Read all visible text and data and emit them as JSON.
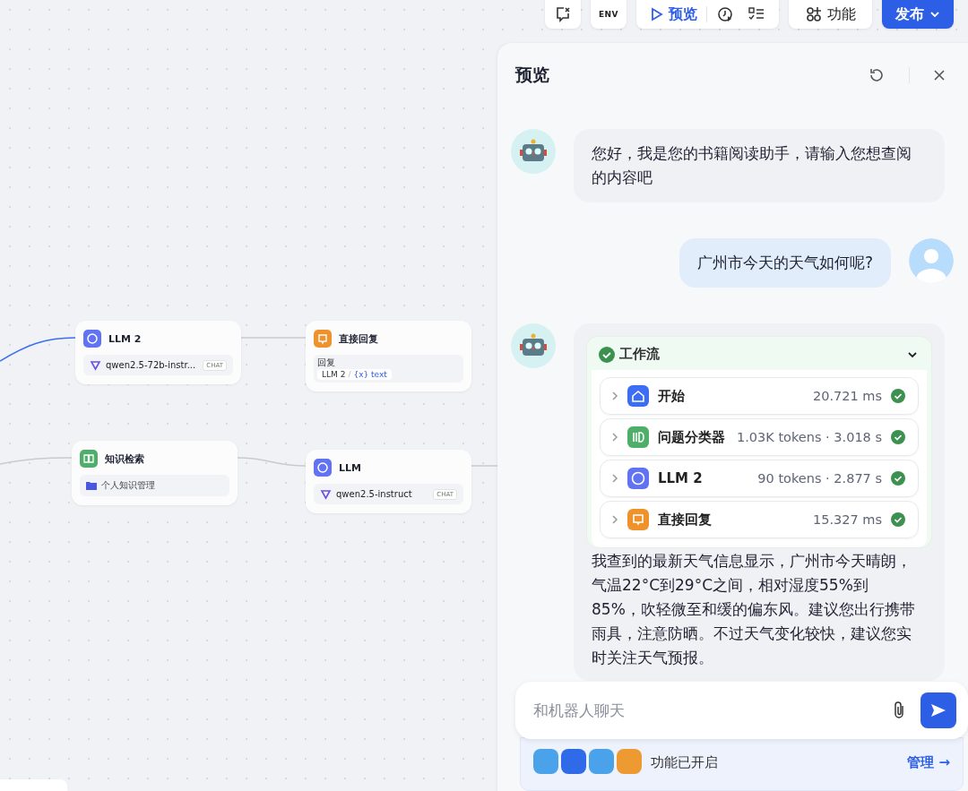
{
  "toolbar": {
    "env_label": "ENV",
    "preview_label": "预览",
    "features_label": "功能",
    "publish_label": "发布"
  },
  "nodes": [
    {
      "kind": "llm",
      "title": "LLM 2",
      "model": "qwen2.5-72b-instr...",
      "tag": "CHAT"
    },
    {
      "kind": "reply",
      "title": "直接回复",
      "field_label": "回复",
      "source": "LLM 2",
      "separator": "/",
      "variable": "{x} text"
    },
    {
      "kind": "knowledge",
      "title": "知识检索",
      "dataset": "个人知识管理"
    },
    {
      "kind": "llm",
      "title": "LLM",
      "model": "qwen2.5-instruct",
      "tag": "CHAT"
    }
  ],
  "preview": {
    "title": "预览",
    "messages": [
      {
        "kind": "bot",
        "text": "您好，我是您的书籍阅读助手，请输入您想查阅的内容吧"
      },
      {
        "kind": "user",
        "text": "广州市今天的天气如何呢?"
      },
      {
        "kind": "bot",
        "workflow": {
          "title": "工作流",
          "expanded": true,
          "steps": [
            {
              "kind": "start",
              "name": "开始",
              "stats": "20.721 ms",
              "success": true
            },
            {
              "kind": "classifier",
              "name": "问题分类器",
              "stats": "1.03K tokens · 3.018 s",
              "success": true
            },
            {
              "kind": "llm",
              "name": "LLM 2",
              "stats": "90 tokens · 2.877 s",
              "success": true
            },
            {
              "kind": "reply",
              "name": "直接回复",
              "stats": "15.327 ms",
              "success": true
            }
          ]
        },
        "text": "我查到的最新天气信息显示，广州市今天晴朗，气温22°C到29°C之间，相对湿度55%到85%，吹轻微至和缓的偏东风。建议您出行携带雨具，注意防晒。不过天气变化较快，建议您实时关注天气预报。"
      }
    ],
    "input": {
      "placeholder": "和机器人聊天"
    },
    "features": {
      "label": "功能已开启",
      "manage_label": "管理 →"
    }
  }
}
